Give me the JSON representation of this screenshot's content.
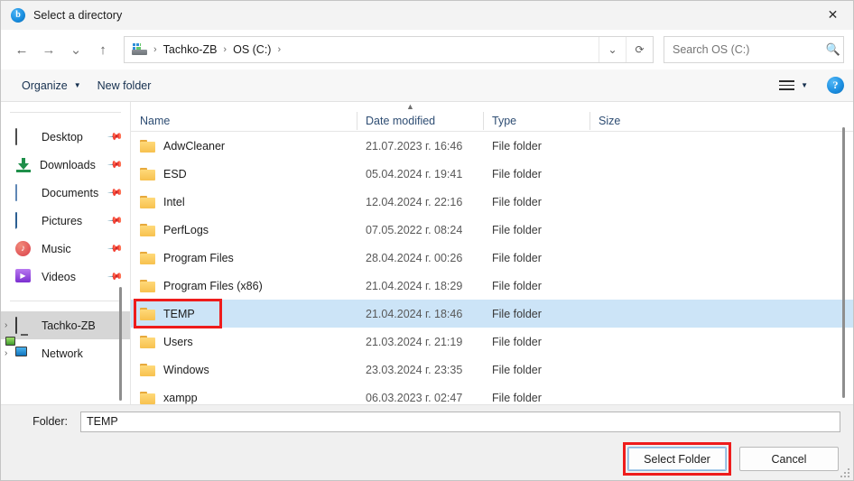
{
  "window": {
    "title": "Select a directory",
    "icon": "app-icon",
    "close_label": "✕"
  },
  "nav": {
    "back": "←",
    "forward": "→",
    "recent": "⌄",
    "up": "↑",
    "refresh": "⟳",
    "dropdown": "⌄",
    "breadcrumb": [
      "Tachko-ZB",
      "OS (C:)"
    ],
    "separator": "›"
  },
  "search": {
    "placeholder": "Search OS (C:)",
    "value": "",
    "icon": "🔍"
  },
  "toolbar": {
    "organize_label": "Organize",
    "organize_caret": "▼",
    "new_folder_label": "New folder",
    "view_caret": "▼",
    "help_label": "?"
  },
  "sidebar": {
    "quick": [
      {
        "label": "Desktop",
        "icon": "desktop-icon",
        "pinned": true
      },
      {
        "label": "Downloads",
        "icon": "download-icon",
        "pinned": true
      },
      {
        "label": "Documents",
        "icon": "document-icon",
        "pinned": true
      },
      {
        "label": "Pictures",
        "icon": "pictures-icon",
        "pinned": true
      },
      {
        "label": "Music",
        "icon": "music-icon",
        "pinned": true
      },
      {
        "label": "Videos",
        "icon": "video-icon",
        "pinned": true
      }
    ],
    "tree": [
      {
        "label": "Tachko-ZB",
        "icon": "pc-icon",
        "selected": true,
        "chevron": "›"
      },
      {
        "label": "Network",
        "icon": "network-icon",
        "selected": false,
        "chevron": "›"
      }
    ],
    "pin_glyph": "📌"
  },
  "filelist": {
    "sort_indicator": "▲",
    "columns": [
      {
        "key": "name",
        "label": "Name"
      },
      {
        "key": "date",
        "label": "Date modified"
      },
      {
        "key": "type",
        "label": "Type"
      },
      {
        "key": "size",
        "label": "Size"
      }
    ],
    "rows": [
      {
        "name": "AdwCleaner",
        "date": "21.07.2023 г. 16:46",
        "type": "File folder",
        "size": "",
        "selected": false
      },
      {
        "name": "ESD",
        "date": "05.04.2024 г. 19:41",
        "type": "File folder",
        "size": "",
        "selected": false
      },
      {
        "name": "Intel",
        "date": "12.04.2024 г. 22:16",
        "type": "File folder",
        "size": "",
        "selected": false
      },
      {
        "name": "PerfLogs",
        "date": "07.05.2022 г. 08:24",
        "type": "File folder",
        "size": "",
        "selected": false
      },
      {
        "name": "Program Files",
        "date": "28.04.2024 г. 00:26",
        "type": "File folder",
        "size": "",
        "selected": false
      },
      {
        "name": "Program Files (x86)",
        "date": "21.04.2024 г. 18:29",
        "type": "File folder",
        "size": "",
        "selected": false
      },
      {
        "name": "TEMP",
        "date": "21.04.2024 г. 18:46",
        "type": "File folder",
        "size": "",
        "selected": true
      },
      {
        "name": "Users",
        "date": "21.03.2024 г. 21:19",
        "type": "File folder",
        "size": "",
        "selected": false
      },
      {
        "name": "Windows",
        "date": "23.03.2024 г. 23:35",
        "type": "File folder",
        "size": "",
        "selected": false
      },
      {
        "name": "xampp",
        "date": "06.03.2023 г. 02:47",
        "type": "File folder",
        "size": "",
        "selected": false
      }
    ]
  },
  "footer": {
    "folder_label": "Folder:",
    "folder_value": "TEMP",
    "select_button": "Select Folder",
    "cancel_button": "Cancel"
  },
  "colors": {
    "selection": "#cce4f7",
    "annotation": "#ee1c1c",
    "accent": "#1d90e2",
    "folder": "#f7c14e"
  }
}
